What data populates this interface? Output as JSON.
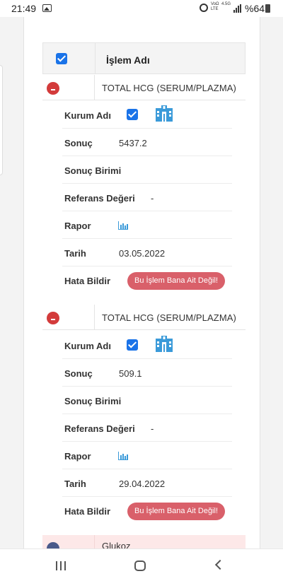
{
  "status_bar": {
    "time": "21:49",
    "network_top": "VoΩ",
    "network_bottom": "LTE",
    "network_gen": "4.5G",
    "battery": "%64"
  },
  "table": {
    "header_label": "İşlem Adı",
    "header_checked": true
  },
  "groups": [
    {
      "name": "TOTAL HCG (SERUM/PLAZMA)",
      "expanded": true,
      "rows": {
        "kurum_label": "Kurum Adı",
        "kurum_checked": true,
        "kurum_icon": "hospital-icon",
        "sonuc_label": "Sonuç",
        "sonuc_value": "5437.2",
        "birim_label": "Sonuç Birimi",
        "birim_value": "",
        "referans_label": "Referans Değeri",
        "referans_value": "-",
        "rapor_label": "Rapor",
        "rapor_icon": "bar-chart-icon",
        "tarih_label": "Tarih",
        "tarih_value": "03.05.2022",
        "hata_label": "Hata Bildir",
        "hata_button": "Bu İşlem Bana Ait Değil!"
      }
    },
    {
      "name": "TOTAL HCG (SERUM/PLAZMA)",
      "expanded": true,
      "rows": {
        "kurum_label": "Kurum Adı",
        "kurum_checked": true,
        "kurum_icon": "hospital-icon",
        "sonuc_label": "Sonuç",
        "sonuc_value": "509.1",
        "birim_label": "Sonuç Birimi",
        "birim_value": "",
        "referans_label": "Referans Değeri",
        "referans_value": "-",
        "rapor_label": "Rapor",
        "rapor_icon": "bar-chart-icon",
        "tarih_label": "Tarih",
        "tarih_value": "29.04.2022",
        "hata_label": "Hata Bildir",
        "hata_button": "Bu İşlem Bana Ait Değil!"
      }
    },
    {
      "name": "Glukoz",
      "expanded": false
    }
  ],
  "colors": {
    "accent": "#1a73e8",
    "danger": "#d33b3b",
    "error_button": "#d9606a",
    "icon_blue": "#3a9ad9",
    "highlight_row": "#fde8e8"
  }
}
